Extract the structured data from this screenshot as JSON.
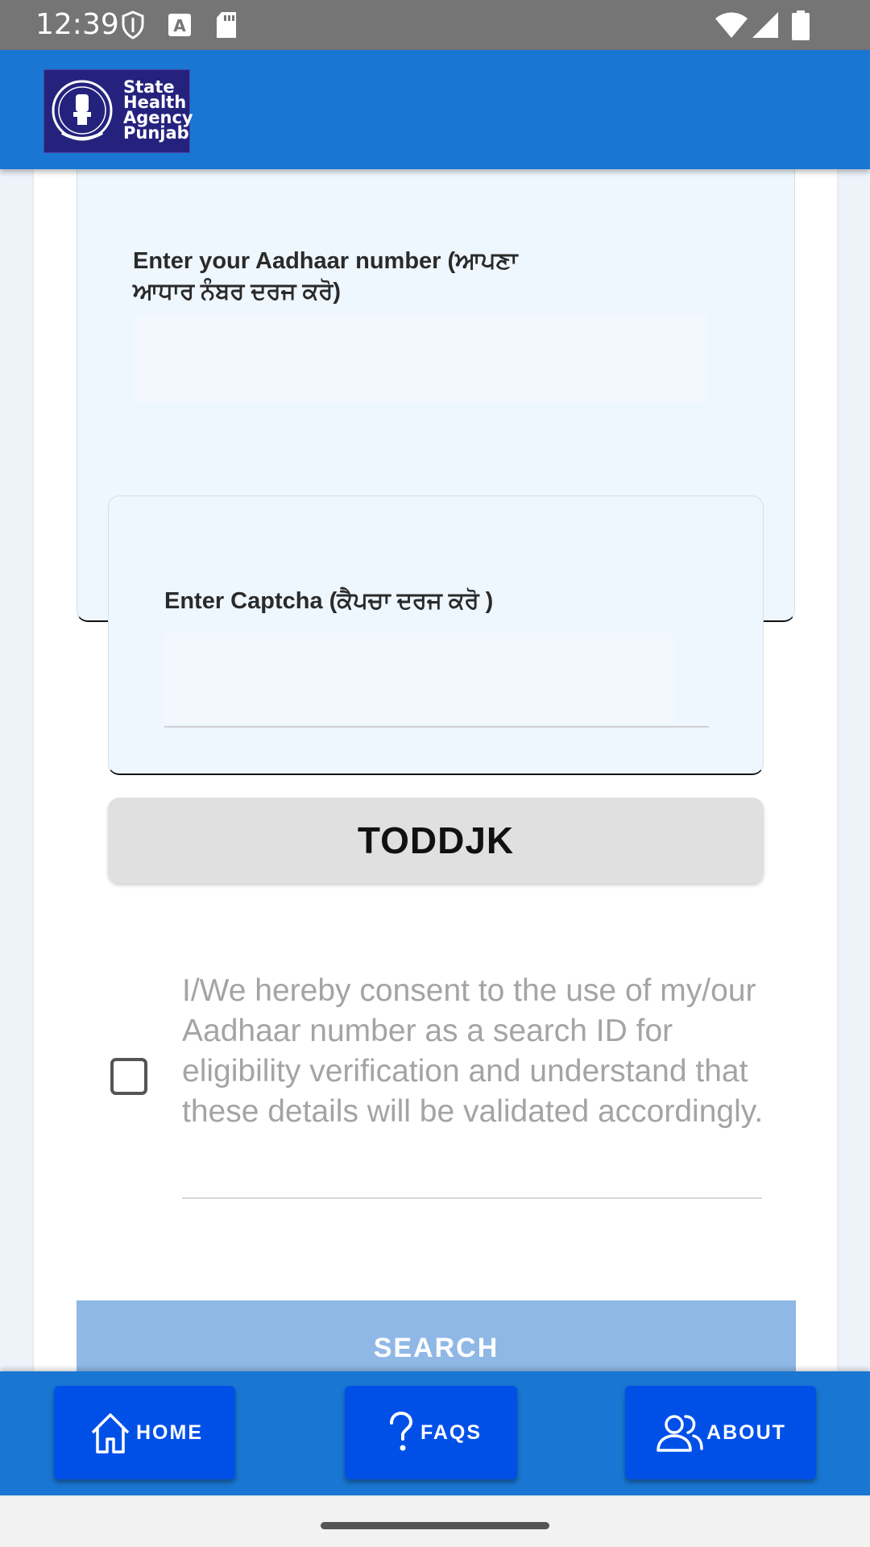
{
  "status_bar": {
    "time": "12:39"
  },
  "app_bar": {
    "logo_lines": [
      "State",
      "Health",
      "Agency",
      "Punjab"
    ]
  },
  "form": {
    "aadhaar_label": "Enter your Aadhaar number (ਆਪਣਾ ਆਧਾਰ ਨੰਬਰ ਦਰਜ ਕਰੋ)",
    "aadhaar_value": "",
    "captcha_label": "Enter Captcha (ਕੈਪਚਾ ਦਰਜ ਕਰੋ )",
    "captcha_value": "",
    "captcha_code": "TODDJK",
    "consent_checked": false,
    "consent_text": "I/We hereby consent to the use of my/our Aadhaar number as a search ID for eligibility verification and understand that these details will be validated accordingly.",
    "search_label": "SEARCH"
  },
  "bottom_nav": {
    "home_label": "HOME",
    "faqs_label": "FAQS",
    "about_label": "ABOUT"
  },
  "colors": {
    "app_bar": "#1976d2",
    "nav_button": "#0050e8",
    "search_button_disabled": "#8fb8e6",
    "status_bar": "#757575"
  },
  "icons": {
    "status": [
      "shield-icon",
      "font-icon",
      "sd-card-icon",
      "wifi-icon",
      "signal-icon",
      "battery-icon"
    ],
    "nav": [
      "home-icon",
      "help-icon",
      "people-icon"
    ]
  }
}
